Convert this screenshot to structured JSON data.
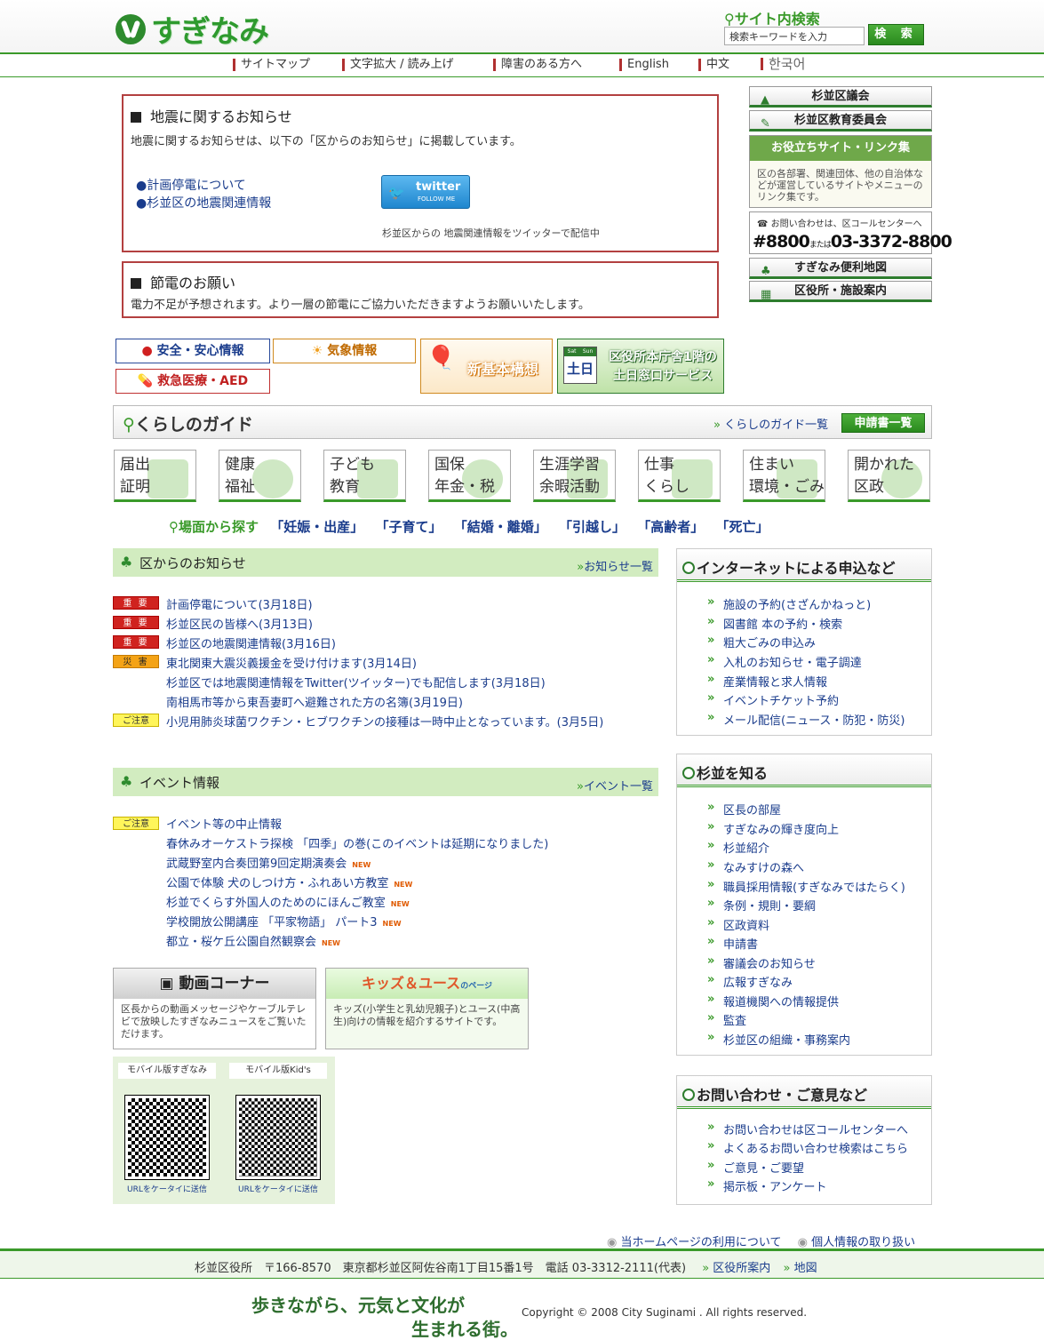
{
  "header": {
    "logo_text": "すぎなみ",
    "search_title": "サイト内検索",
    "search_placeholder": "検索キーワードを入力",
    "search_button": "検 索"
  },
  "nav": [
    "サイトマップ",
    "文字拡大 / 読み上げ",
    "障害のある方へ",
    "English",
    "中文",
    "한국어"
  ],
  "notice1": {
    "title": "地震に関するお知らせ",
    "body": "地震に関するお知らせは、以下の「区からのお知らせ」に掲載しています。",
    "link1": "●計画停電について",
    "link2": "●杉並区の地震関連情報",
    "twitter_main": "twitter",
    "twitter_sub": "FOLLOW ME",
    "twitter_caption": "杉並区からの 地震関連情報をツイッターで配信中"
  },
  "notice2": {
    "title": "節電のお願い",
    "body": "電力不足が予想されます。より一層の節電にご協力いただきますようお願いいたします。"
  },
  "right_banners": {
    "gikai": "杉並区議会",
    "kyoiku": "杉並区教育委員会",
    "links_title": "お役立ちサイト・リンク集",
    "links_body": "区の各部署、関連団体、他の自治体などが運営しているサイトやメニューのリンク集です。",
    "call_label": "お問い合わせは、区コールセンターへ",
    "call_num1": "#8800",
    "call_or": "または",
    "call_num2": "03-3372-8800",
    "map": "すぎなみ便利地図",
    "facility": "区役所・施設案内"
  },
  "small_banners": {
    "safety": "安全・安心情報",
    "weather": "気象情報",
    "emergency": "救急医療・AED",
    "plan": "新基本構想",
    "weekend_line1": "区役所本庁舎1階の",
    "weekend_line2": "土日窓口サービス",
    "cal_sat": "Sat",
    "cal_sun": "Sun",
    "cal_day": "土日"
  },
  "guide": {
    "title": "くらしのガイド",
    "list_link": "くらしのガイド一覧",
    "apply_button": "申請書一覧",
    "categories": [
      {
        "l1": "届出",
        "l2": "証明"
      },
      {
        "l1": "健康",
        "l2": "福祉"
      },
      {
        "l1": "子ども",
        "l2": "教育"
      },
      {
        "l1": "国保",
        "l2": "年金・税"
      },
      {
        "l1": "生涯学習",
        "l2": "余暇活動"
      },
      {
        "l1": "仕事",
        "l2": "くらし"
      },
      {
        "l1": "住まい",
        "l2": "環境・ごみ"
      },
      {
        "l1": "開かれた",
        "l2": "区政"
      }
    ],
    "scene_label": "場面から探す",
    "scenes": [
      "「妊娠・出産」",
      "「子育て」",
      "「結婚・離婚」",
      "「引越し」",
      "「高齢者」",
      "「死亡」"
    ]
  },
  "news": {
    "title": "区からのお知らせ",
    "more": "お知らせ一覧",
    "items": [
      {
        "badge": "重 要",
        "text": "計画停電について(3月18日)"
      },
      {
        "badge": "重 要",
        "text": "杉並区民の皆様へ(3月13日)"
      },
      {
        "badge": "重 要",
        "text": "杉並区の地震関連情報(3月16日)"
      },
      {
        "badge": "災 害",
        "text": "東北関東大震災義援金を受け付けます(3月14日)"
      },
      {
        "badge": "",
        "text": "杉並区では地震関連情報をTwitter(ツイッター)でも配信します(3月18日)"
      },
      {
        "badge": "",
        "text": "南相馬市等から東吾妻町へ避難された方の名簿(3月19日)"
      },
      {
        "badge": "ご注意",
        "text": "小児用肺炎球菌ワクチン・ヒブワクチンの接種は一時中止となっています。(3月5日)"
      }
    ]
  },
  "events": {
    "title": "イベント情報",
    "more": "イベント一覧",
    "badge": "ご注意",
    "new_label": "NEW",
    "items": [
      "イベント等の中止情報",
      "春休みオーケストラ探検 「四季」の巻(このイベントは延期になりました)",
      "武蔵野室内合奏団第9回定期演奏会",
      "公園で体験 犬のしつけ方・ふれあい方教室",
      "杉並でくらす外国人のためのにほんご教室",
      "学校開放公開講座 「平家物語」 パート3",
      "都立・桜ケ丘公園自然観察会"
    ]
  },
  "video": {
    "title": "動画コーナー",
    "body": "区長からの動画メッセージやケーブルテレビで放映したすぎなみニュースをご覧いただけます。"
  },
  "kids": {
    "title": "キッズ＆ユース",
    "sub": "のページ",
    "body": "キッズ(小学生と乳幼児親子)とユース(中高生)向けの情報を紹介するサイトです。"
  },
  "mobile": {
    "label1": "モバイル版すぎなみ",
    "label2": "モバイル版Kid's",
    "send": "URLをケータイに送信"
  },
  "panel_internet": {
    "title": "インターネットによる申込など",
    "items": [
      "施設の予約(さざんかねっと)",
      "図書館 本の予約・検索",
      "粗大ごみの申込み",
      "入札のお知らせ・電子調達",
      "産業情報と求人情報",
      "イベントチケット予約",
      "メール配信(ニュース・防犯・防災)"
    ]
  },
  "panel_know": {
    "title": "杉並を知る",
    "items": [
      "区長の部屋",
      "すぎなみの輝き度向上",
      "杉並紹介",
      "なみすけの森へ",
      "職員採用情報(すぎなみではたらく)",
      "条例・規則・要綱",
      "区政資料",
      "申請書",
      "審議会のお知らせ",
      "広報すぎなみ",
      "報道機関への情報提供",
      "監査",
      "杉並区の組織・事務案内"
    ]
  },
  "panel_contact": {
    "title": "お問い合わせ・ご意見など",
    "items": [
      "お問い合わせは区コールセンターへ",
      "よくあるお問い合わせ検索はこちら",
      "ご意見・ご要望",
      "掲示板・アンケート"
    ]
  },
  "footer": {
    "usage": "当ホームページの利用について",
    "privacy": "個人情報の取り扱い",
    "address": "杉並区役所　〒166-8570　東京都杉並区阿佐谷南1丁目15番1号　電話 03-3312-2111(代表)",
    "office_link": "区役所案内",
    "map_link": "地図",
    "slogan1": "歩きながら、元気と文化が",
    "slogan2": "生まれる街。",
    "copyright": "Copyright © 2008 City Suginami . All rights reserved."
  },
  "colors": {
    "green": "#3a9a2a",
    "red_border": "#b34040",
    "link": "#1a3c8c"
  }
}
